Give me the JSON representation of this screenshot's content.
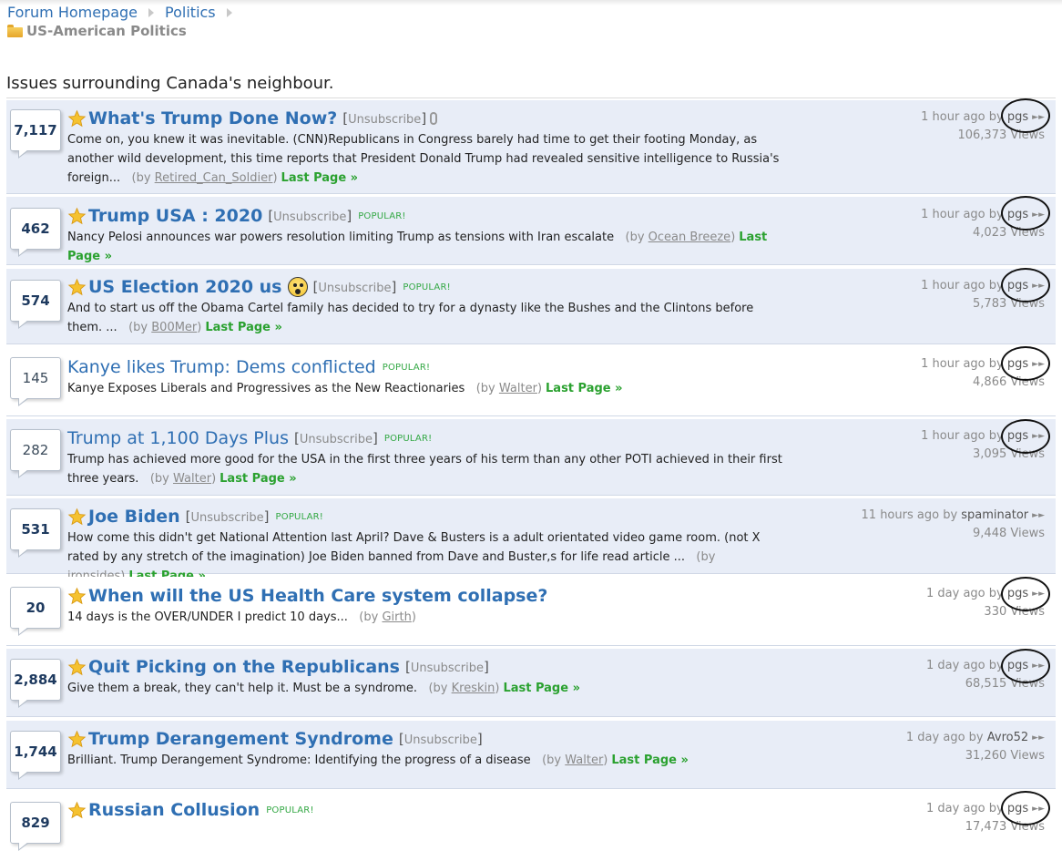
{
  "breadcrumb": {
    "home": "Forum Homepage",
    "section": "Politics"
  },
  "forum": {
    "title": "US-American Politics",
    "description": "Issues surrounding Canada's neighbour."
  },
  "labels": {
    "unsubscribe": "Unsubscribe",
    "popular": "POPULAR!",
    "last_page": "Last Page »",
    "by": "by"
  },
  "threads": [
    {
      "replies": "7,117",
      "title": "What's Trump Done Now?",
      "subscribed": true,
      "popular": false,
      "snippet": "Come on, you knew it was inevitable. (CNN)Republicans in Congress barely had time to get their footing Monday, as another wild development, this time reports that President Donald Trump had revealed sensitive intelligence to Russia's foreign...",
      "author": "Retired_Can_Soldier",
      "last_post_time": "1 hour ago",
      "last_poster": "pgs",
      "views": "106,373 Views"
    },
    {
      "replies": "462",
      "title": "Trump USA : 2020",
      "subscribed": true,
      "popular": true,
      "snippet": "Nancy Pelosi announces war powers resolution limiting Trump as tensions with Iran escalate",
      "author": "Ocean Breeze",
      "last_post_time": "1 hour ago",
      "last_poster": "pgs",
      "views": "4,023 Views"
    },
    {
      "replies": "574",
      "title": "US Election 2020 us",
      "subscribed": true,
      "popular": true,
      "snippet": "And to start us off the Obama Cartel family has decided to try for a dynasty like the Bushes and the Clintons before them. ...",
      "author": "B00Mer",
      "last_post_time": "1 hour ago",
      "last_poster": "pgs",
      "views": "5,783 Views"
    },
    {
      "replies": "145",
      "title": "Kanye likes Trump: Dems conflicted",
      "subscribed": false,
      "popular": true,
      "snippet": "Kanye Exposes Liberals and Progressives as the New Reactionaries",
      "author": "Walter",
      "last_post_time": "1 hour ago",
      "last_poster": "pgs",
      "views": "4,866 Views"
    },
    {
      "replies": "282",
      "title": "Trump at 1,100 Days Plus",
      "subscribed": false,
      "popular": true,
      "snippet": "Trump has achieved more good for the USA in the first three years of his term than any other POTI achieved in their first three years.",
      "author": "Walter",
      "last_post_time": "1 hour ago",
      "last_poster": "pgs",
      "views": "3,095 Views"
    },
    {
      "replies": "531",
      "title": "Joe Biden",
      "subscribed": true,
      "popular": true,
      "snippet": "How come this didn't get National Attention last April? Dave & Busters is a adult orientated video game room. (not X rated by any stretch of the imagination) Joe Biden banned from Dave and Buster,s for life read article ...",
      "author": "ironsides",
      "last_post_time": "11 hours ago",
      "last_poster": "spaminator",
      "views": "9,448 Views"
    },
    {
      "replies": "20",
      "title": "When will the US Health Care system collapse?",
      "subscribed": true,
      "popular": false,
      "snippet": "14 days is the OVER/UNDER I predict 10 days...",
      "author": "Girth",
      "last_post_time": "1 day ago",
      "last_poster": "pgs",
      "views": "330 Views"
    },
    {
      "replies": "2,884",
      "title": "Quit Picking on the Republicans",
      "subscribed": true,
      "popular": false,
      "snippet": "Give them a break, they can't help it. Must be a syndrome.",
      "author": "Kreskin",
      "last_post_time": "1 day ago",
      "last_poster": "pgs",
      "views": "68,515 Views"
    },
    {
      "replies": "1,744",
      "title": "Trump Derangement Syndrome",
      "subscribed": true,
      "popular": false,
      "snippet": "Brilliant. Trump Derangement Syndrome: Identifying the progress of a disease",
      "author": "Walter",
      "last_post_time": "1 day ago",
      "last_poster": "Avro52",
      "views": "31,260 Views"
    },
    {
      "replies": "829",
      "title": "Russian Collusion",
      "subscribed": true,
      "popular": true,
      "snippet": "",
      "author": "",
      "last_post_time": "1 day ago",
      "last_poster": "pgs",
      "views": "17,473 Views"
    }
  ],
  "colors": {
    "link": "#2f6fb3",
    "row_shade": "#e8edf7",
    "popular": "#33a844",
    "last_page": "#2aa12f",
    "annotation": "#111111"
  }
}
